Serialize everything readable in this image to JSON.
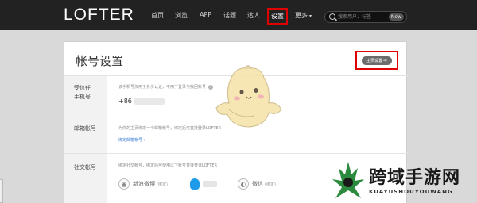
{
  "app": {
    "logo": "LOFTER"
  },
  "nav": {
    "items": [
      "首页",
      "浏览",
      "APP",
      "话题",
      "达人",
      "设置",
      "更多"
    ],
    "active": "设置",
    "more_caret": "▾"
  },
  "search": {
    "placeholder": "搜索用户、标签",
    "badge": "New"
  },
  "page": {
    "title": "帐号设置",
    "homepage_button": "主页设置",
    "homepage_arrow": "➜"
  },
  "sections": {
    "phone": {
      "label_line1": "受信任",
      "label_line2": "手机号",
      "desc": "该手机号仅用于身份认证，不用于登录与找回帐号",
      "number_prefix": "+86"
    },
    "email": {
      "label": "邮箱帐号",
      "desc": "为你的主页绑定一个邮箱帐号，绑定后可直接登录LOFTER",
      "link": "绑定邮箱帐号 ›"
    },
    "social": {
      "label": "社交帐号",
      "desc": "绑定社交帐号，绑定后可使用以下帐号直接登录LOFTER",
      "accounts": [
        {
          "name": "新浪微博",
          "status": "(绑定)",
          "icon": "weibo-icon"
        },
        {
          "name": "",
          "status": "",
          "icon": "qq-icon"
        },
        {
          "name": "微信",
          "status": "(绑定)",
          "icon": "wechat-icon"
        }
      ]
    }
  },
  "watermark": {
    "title": "跨域手游网",
    "subtitle": "KUAYUSHOUYOUWANG"
  },
  "colors": {
    "topbar": "#222222",
    "highlight": "#e00000",
    "link": "#3a7bd5",
    "qq": "#1f9bea"
  }
}
